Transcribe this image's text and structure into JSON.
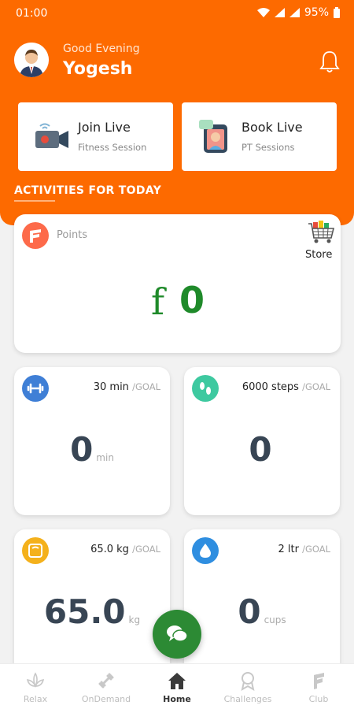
{
  "status_bar": {
    "time": "01:00",
    "battery": "95%"
  },
  "header": {
    "greeting": "Good Evening",
    "user_name": "Yogesh"
  },
  "live_cards": [
    {
      "title": "Join Live",
      "subtitle": "Fitness Session"
    },
    {
      "title": "Book Live",
      "subtitle": "PT Sessions"
    }
  ],
  "activities_title": "ACTIVITIES FOR TODAY",
  "points": {
    "label": "Points",
    "symbol": "f",
    "value": "0",
    "store_label": "Store"
  },
  "stats": [
    {
      "goal": "30 min",
      "goal_label": "/GOAL",
      "value": "0",
      "unit": "min",
      "icon": "dumbbell-icon",
      "color": "#3f7fd6"
    },
    {
      "goal": "6000 steps",
      "goal_label": "/GOAL",
      "value": "0",
      "unit": "",
      "icon": "footsteps-icon",
      "color": "#3ec9a0"
    },
    {
      "goal": "65.0 kg",
      "goal_label": "/GOAL",
      "value": "65.0",
      "unit": "kg",
      "icon": "scale-icon",
      "color": "#f4b11c"
    },
    {
      "goal": "2 ltr",
      "goal_label": "/GOAL",
      "value": "0",
      "unit": "cups",
      "icon": "water-drop-icon",
      "color": "#2f8ee0"
    }
  ],
  "bottom_nav": [
    {
      "label": "Relax",
      "icon": "lotus-icon"
    },
    {
      "label": "OnDemand",
      "icon": "dumbbell-icon"
    },
    {
      "label": "Home",
      "icon": "home-icon",
      "active": true
    },
    {
      "label": "Challenges",
      "icon": "medal-icon"
    },
    {
      "label": "Club",
      "icon": "club-logo-icon"
    }
  ],
  "colors": {
    "brand_orange": "#fd6a00",
    "points_green": "#1f8a2a",
    "fab_green": "#2c8a34"
  }
}
